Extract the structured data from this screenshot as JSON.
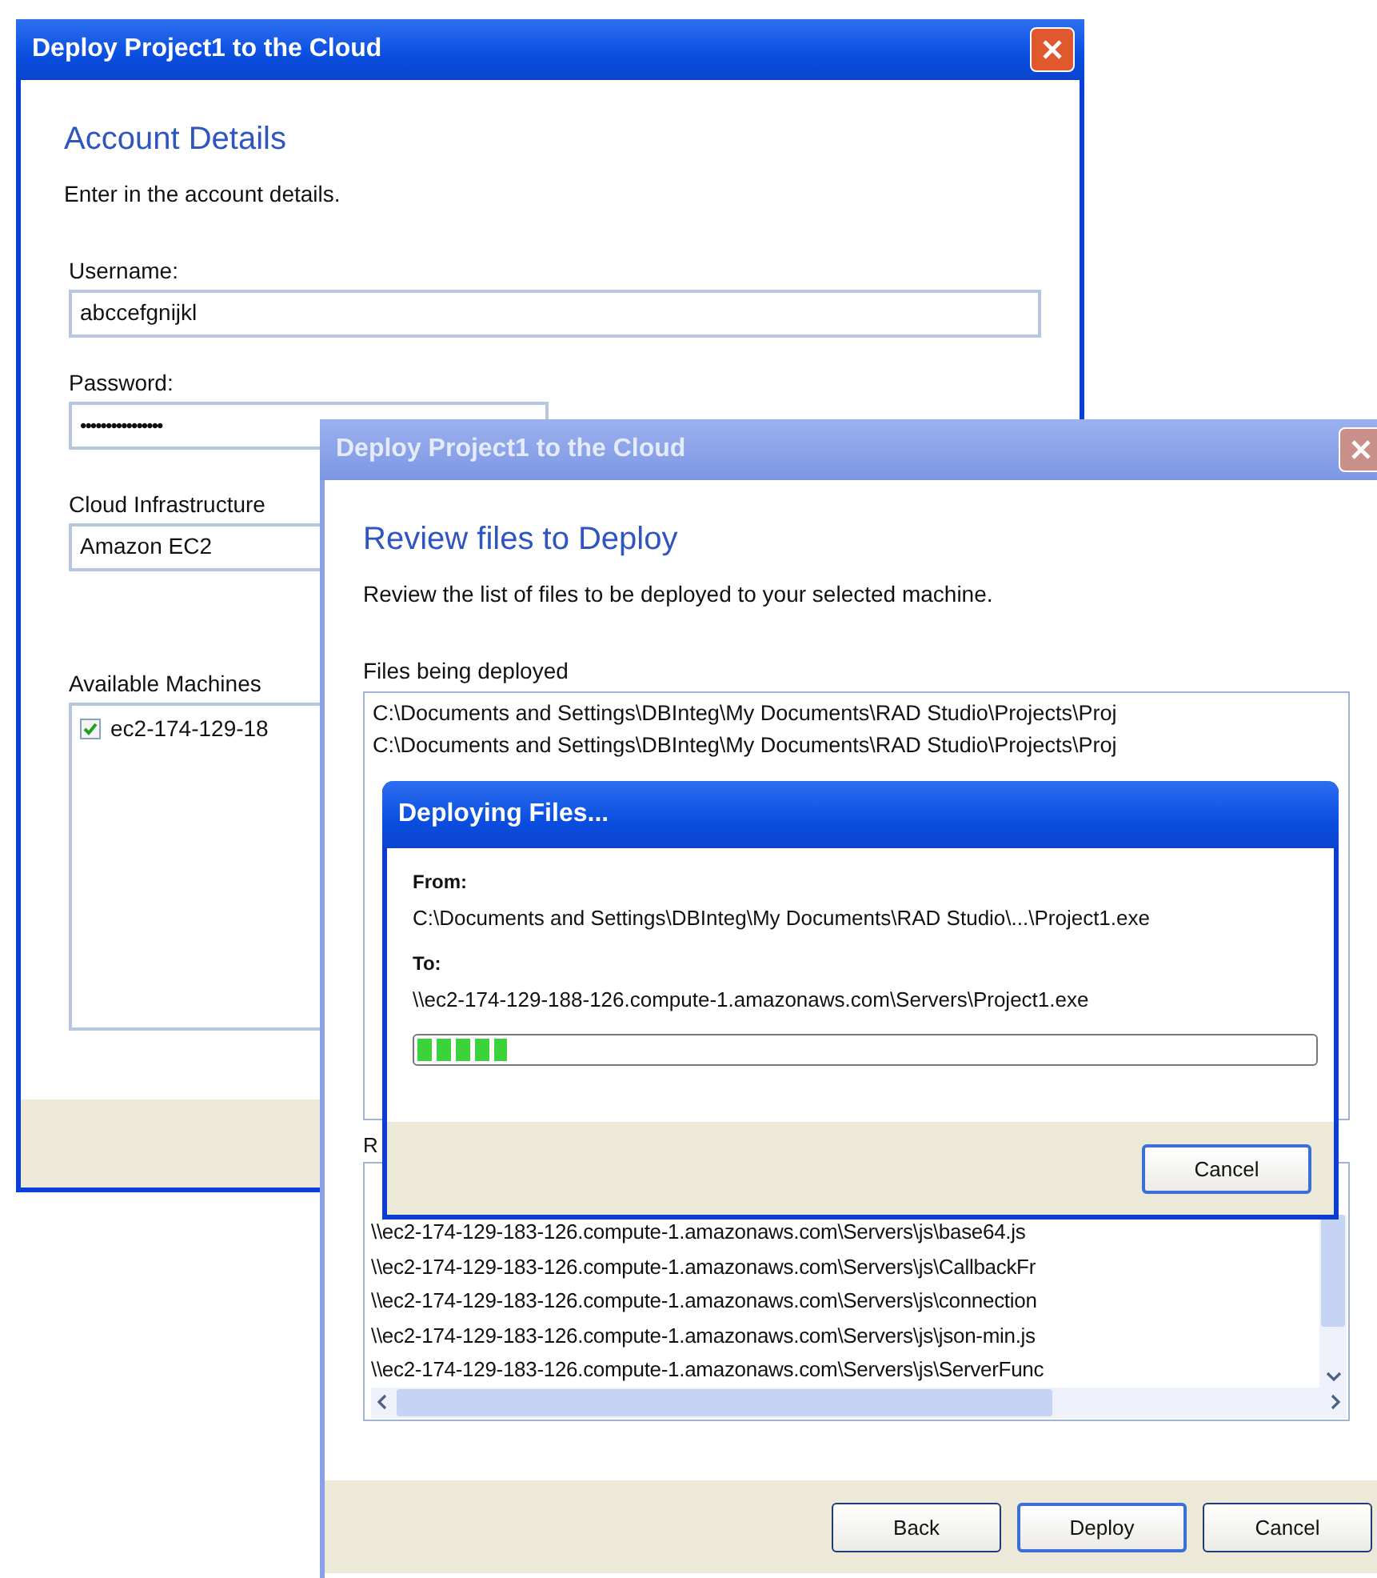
{
  "account_window": {
    "title": "Deploy Project1 to the Cloud",
    "active": true,
    "heading": "Account Details",
    "description": "Enter in the account details.",
    "username": {
      "label": "Username:",
      "value": "abccefgnijkl"
    },
    "password": {
      "label": "Password:",
      "value": "••••••••••••••••"
    },
    "cloud": {
      "label": "Cloud Infrastructure",
      "value": "Amazon EC2"
    },
    "machines": {
      "label": "Available Machines",
      "items": [
        {
          "name": "ec2-174-129-18",
          "checked": true
        }
      ]
    }
  },
  "review_window": {
    "title": "Deploy Project1 to the Cloud",
    "active": false,
    "heading": "Review files to Deploy",
    "description": "Review the list of files to be deployed to your selected machine.",
    "files_label": "Files being deployed",
    "files": [
      "C:\\Documents and Settings\\DBInteg\\My Documents\\RAD Studio\\Projects\\Proj",
      "C:\\Documents and Settings\\DBInteg\\My Documents\\RAD Studio\\Projects\\Proj"
    ],
    "remote_label": "R",
    "remote_files": [
      "\\\\ec2-174-129-183-126.compute-1.amazonaws.com\\Servers\\js\\base64.js",
      "\\\\ec2-174-129-183-126.compute-1.amazonaws.com\\Servers\\js\\CallbackFr",
      "\\\\ec2-174-129-183-126.compute-1.amazonaws.com\\Servers\\js\\connection",
      "\\\\ec2-174-129-183-126.compute-1.amazonaws.com\\Servers\\js\\json-min.js",
      "\\\\ec2-174-129-183-126.compute-1.amazonaws.com\\Servers\\js\\ServerFunc"
    ],
    "buttons": [
      "Back",
      "Deploy",
      "Cancel"
    ]
  },
  "progress_dialog": {
    "title": "Deploying Files...",
    "active": true,
    "from_label": "From:",
    "from": "C:\\Documents and Settings\\DBInteg\\My Documents\\RAD Studio\\...\\Project1.exe",
    "to_label": "To:",
    "to": "\\\\ec2-174-129-188-126.compute-1.amazonaws.com\\Servers\\Project1.exe",
    "level": 0.1,
    "button": "Cancel"
  }
}
